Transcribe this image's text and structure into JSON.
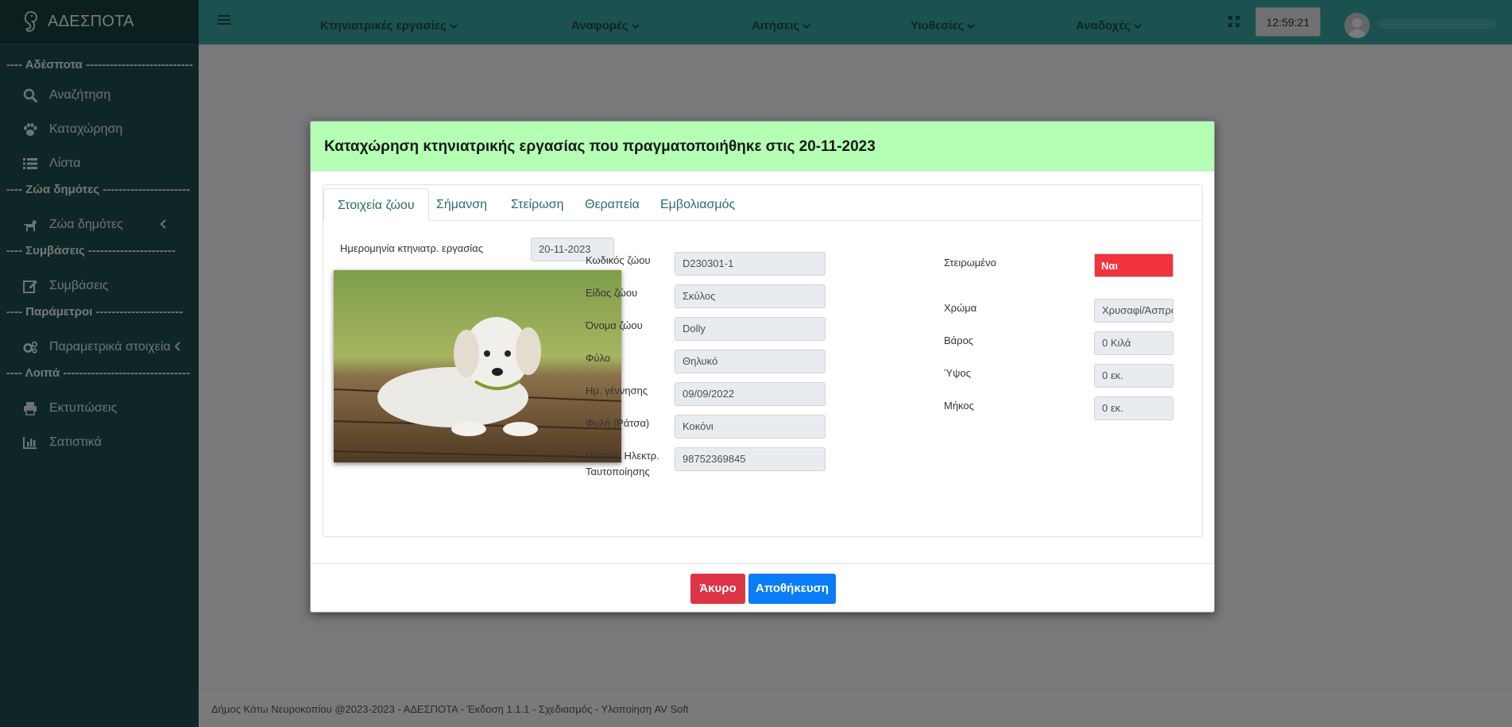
{
  "app": {
    "title": "ΑΔΕΣΠΟΤΑ"
  },
  "sidebar": {
    "sections": [
      {
        "label": "---- Αδέσποτα ---------------------------"
      },
      {
        "label": "---- Ζώα δημότες ----------------------"
      },
      {
        "label": "---- Συμβάσεις ----------------------"
      },
      {
        "label": "---- Παράμετροι ----------------------"
      },
      {
        "label": "---- Λοιπά --------------------------------"
      }
    ],
    "items": [
      {
        "label": "Αναζήτηση",
        "icon": "search-icon"
      },
      {
        "label": "Καταχώρηση",
        "icon": "paw-icon"
      },
      {
        "label": "Λίστα",
        "icon": "list-icon"
      },
      {
        "label": "Ζώα δημότες",
        "icon": "dog-icon"
      },
      {
        "label": "Συμβάσεις",
        "icon": "edit-icon"
      },
      {
        "label": "Παραμετρικά στοιχεία",
        "icon": "cogs-icon"
      },
      {
        "label": "Εκτυπώσεις",
        "icon": "print-icon"
      },
      {
        "label": "Σατιστικά",
        "icon": "bar-chart-icon"
      }
    ]
  },
  "topbar": {
    "menus": [
      {
        "label": "Κτηνιατρικές εργασίες"
      },
      {
        "label": "Αναφορές"
      },
      {
        "label": "Αιτήσεις"
      },
      {
        "label": "Υιοθεσίες"
      },
      {
        "label": "Αναδοχές"
      }
    ],
    "clock": "12:59:21"
  },
  "modal": {
    "title": "Καταχώρηση κτηνιατρικής εργασίας που πραγματοποιήθηκε στις 20-11-2023",
    "tabs": [
      {
        "label": "Στοιχεία ζώου",
        "active": true
      },
      {
        "label": "Σήμανση"
      },
      {
        "label": "Στείρωση"
      },
      {
        "label": "Θεραπεία"
      },
      {
        "label": "Εμβολιασμός"
      }
    ],
    "date_label": "Ημερομηνία κτηνιατρ. εργασίας",
    "date_value": "20-11-2023",
    "fields": [
      {
        "label": "Κωδικός ζώου",
        "value": "D230301-1"
      },
      {
        "label": "Είδος ζώου",
        "value": "Σκύλος"
      },
      {
        "label": "Όνομα ζώου",
        "value": "Dolly"
      },
      {
        "label": "Φύλο",
        "value": "Θηλυκό"
      },
      {
        "label": "Ημ. γέννησης",
        "value": "09/09/2022"
      },
      {
        "label": "Φυλή (Ράτσα)",
        "value": "Κοκόνι"
      },
      {
        "label": "Πιστοπ. Ηλεκτρ. Ταυτοποίησης",
        "value": "98752369845"
      }
    ],
    "right_fields": {
      "sterilized": {
        "label": "Στειρωμένο",
        "value": "Ναι",
        "color": "#f1343c"
      },
      "color": {
        "label": "Χρώμα",
        "value": "Χρυσαφί/Άσπρο"
      },
      "weight": {
        "label": "Βάρος",
        "value": "0 Κιλά"
      },
      "height": {
        "label": "Ύψος",
        "value": "0 εκ."
      },
      "length": {
        "label": "Μήκος",
        "value": "0 εκ."
      }
    },
    "buttons": {
      "cancel": "Άκυρο",
      "save": "Αποθήκευση"
    }
  },
  "footer": {
    "text": "Δήμος Κάτω Νευροκοπίου @2023-2023 - ΑΔΕΣΠΟΤΑ - Έκδοση 1.1.1 - Σχεδιασμός - Υλοποίηση AV Soft"
  },
  "colors": {
    "sidebar": "#1d4f4d",
    "topbar": "#37a4a0",
    "modal_header": "#b4ffb4",
    "danger": "#dc3545",
    "primary": "#0a7cf7"
  }
}
